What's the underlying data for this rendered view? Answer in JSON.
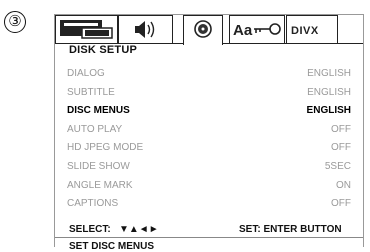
{
  "step_marker": "③",
  "menu": {
    "title": "DISK SETUP",
    "rows": [
      {
        "label": "DIALOG",
        "value": "ENGLISH",
        "state": "dim"
      },
      {
        "label": "SUBTITLE",
        "value": "ENGLISH",
        "state": "dim"
      },
      {
        "label": "DISC MENUS",
        "value": "ENGLISH",
        "state": "sel"
      },
      {
        "label": "AUTO PLAY",
        "value": "OFF",
        "state": "dim"
      },
      {
        "label": "HD JPEG MODE",
        "value": "OFF",
        "state": "dim"
      },
      {
        "label": "SLIDE SHOW",
        "value": "5SEC",
        "state": "dim"
      },
      {
        "label": "ANGLE MARK",
        "value": "ON",
        "state": "dim"
      },
      {
        "label": "CAPTIONS",
        "value": "OFF",
        "state": "dim"
      }
    ],
    "select_hint": "SELECT:",
    "select_arrows": "▼▲◄►",
    "set_hint": "SET: ENTER BUTTON",
    "status": "SET DISC MENUS"
  },
  "tabs": [
    {
      "icon": "tv-system-icon"
    },
    {
      "icon": "speaker-audio-icon"
    },
    {
      "icon": "disc-icon",
      "active": true
    },
    {
      "icon": "language-key-icon",
      "text": "Aa"
    },
    {
      "icon": "divx-icon",
      "text": "DIVX"
    }
  ]
}
